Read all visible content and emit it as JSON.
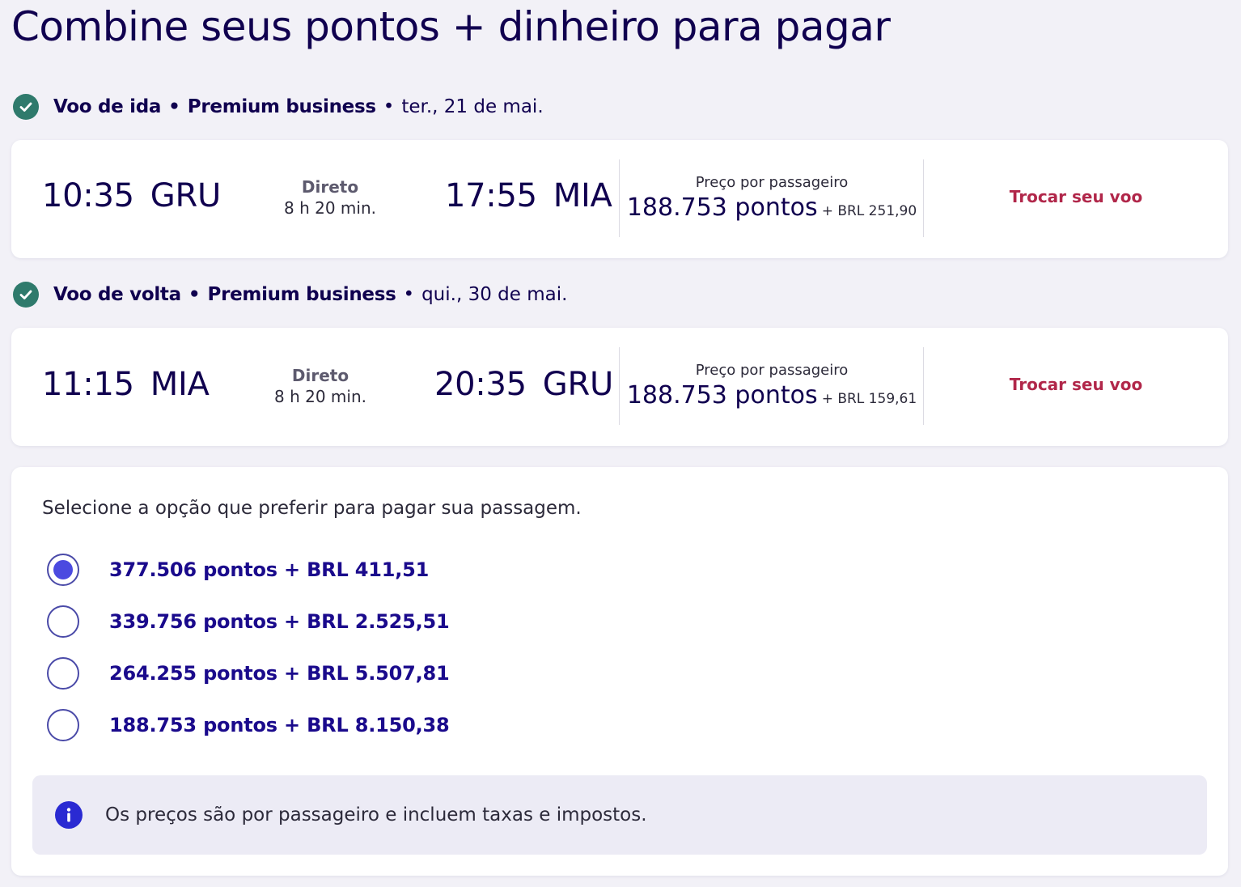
{
  "page": {
    "title": "Combine seus pontos + dinheiro para pagar"
  },
  "outbound": {
    "header_leg": "Voo de ida",
    "header_cabin": "Premium business",
    "header_date": "ter., 21 de mai.",
    "depart_time": "10:35",
    "depart_airport": "GRU",
    "stops_label": "Direto",
    "duration": "8 h 20 min.",
    "arrive_time": "17:55",
    "arrive_airport": "MIA",
    "price_label": "Preço por passageiro",
    "price_points": "188.753 pontos",
    "price_cash": "+ BRL 251,90",
    "change_label": "Trocar seu voo"
  },
  "inbound": {
    "header_leg": "Voo de volta",
    "header_cabin": "Premium business",
    "header_date": "qui., 30 de mai.",
    "depart_time": "11:15",
    "depart_airport": "MIA",
    "stops_label": "Direto",
    "duration": "8 h 20 min.",
    "arrive_time": "20:35",
    "arrive_airport": "GRU",
    "price_label": "Preço por passageiro",
    "price_points": "188.753 pontos",
    "price_cash": "+ BRL 159,61",
    "change_label": "Trocar seu voo"
  },
  "payment": {
    "intro": "Selecione a opção que preferir para pagar sua passagem.",
    "options": [
      {
        "label": "377.506 pontos + BRL 411,51",
        "selected": true
      },
      {
        "label": "339.756 pontos + BRL 2.525,51",
        "selected": false
      },
      {
        "label": "264.255 pontos + BRL 5.507,81",
        "selected": false
      },
      {
        "label": "188.753 pontos + BRL 8.150,38",
        "selected": false
      }
    ],
    "info_text": "Os preços são por passageiro e incluem taxas e impostos."
  },
  "icons": {
    "leg_status": "check-circle-icon",
    "info": "info-icon",
    "radio": "radio-button"
  },
  "colors": {
    "background": "#f2f1f7",
    "primary_text": "#10004f",
    "success_check": "#2f7a6c",
    "link_red": "#b1274a",
    "radio_selected": "#4b4ae0",
    "info_icon": "#2a2ad2",
    "info_bg": "#ecebf5"
  }
}
